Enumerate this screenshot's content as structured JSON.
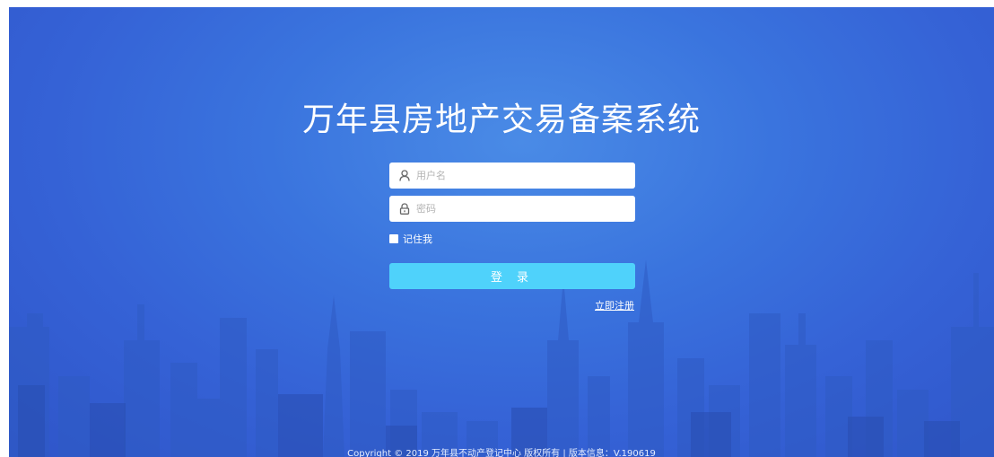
{
  "title": "万年县房地产交易备案系统",
  "login_form": {
    "username_placeholder": "用户名",
    "password_placeholder": "密码",
    "remember_label": "记住我",
    "login_button": "登 录",
    "register_link": "立即注册"
  },
  "icons": {
    "username": "user-icon",
    "password": "lock-icon"
  },
  "colors": {
    "background": "#3a6fdb",
    "button": "#4fd2fb",
    "text": "#ffffff"
  },
  "footer": "Copyright © 2019 万年县不动产登记中心 版权所有 | 版本信息：V.190619"
}
